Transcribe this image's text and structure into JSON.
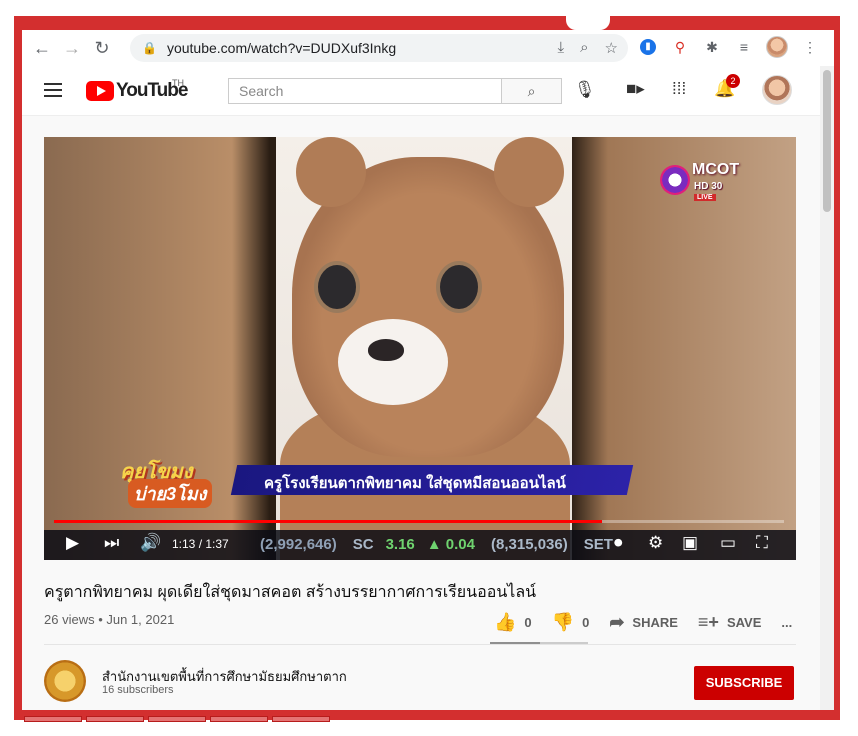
{
  "browser": {
    "url": "youtube.com/watch?v=DUDXuf3Inkg",
    "back_icon": "arrow-left-icon",
    "forward_icon": "arrow-right-icon",
    "reload_icon": "reload-icon"
  },
  "header": {
    "logo_text": "YouTube",
    "region": "TH",
    "search_placeholder": "Search",
    "notification_count": "2"
  },
  "video": {
    "channel_logo_main": "MCOT",
    "channel_logo_sub": "HD 30",
    "live_label": "LIVE",
    "show_title_line1": "คุยโขมง",
    "show_title_line2": "บ่าย3โมง",
    "banner_text": "ครูโรงเรียนตากพิทยาคม  ใส่ชุดหมีสอนออนไลน์",
    "ticker": {
      "left": "(2,992,646)",
      "label": "SC",
      "value": "3.16",
      "change": "▲ 0.04",
      "volume": "(8,315,036)",
      "tail": "SET"
    },
    "time_display": "1:13 / 1:37",
    "progress": 0.75
  },
  "info": {
    "title": "ครูตากพิทยาคม ผุดเดียใส่ชุดมาสคอต สร้างบรรยากาศการเรียนออนไลน์",
    "views_date": "26 views • Jun 1, 2021",
    "likes": "0",
    "dislikes": "0",
    "share_label": "SHARE",
    "save_label": "SAVE",
    "more_label": "..."
  },
  "channel": {
    "name": "สำนักงานเขตพื้นที่การศึกษามัธยมศึกษาตาก",
    "subscribers": "16 subscribers",
    "subscribe_label": "SUBSCRIBE"
  }
}
